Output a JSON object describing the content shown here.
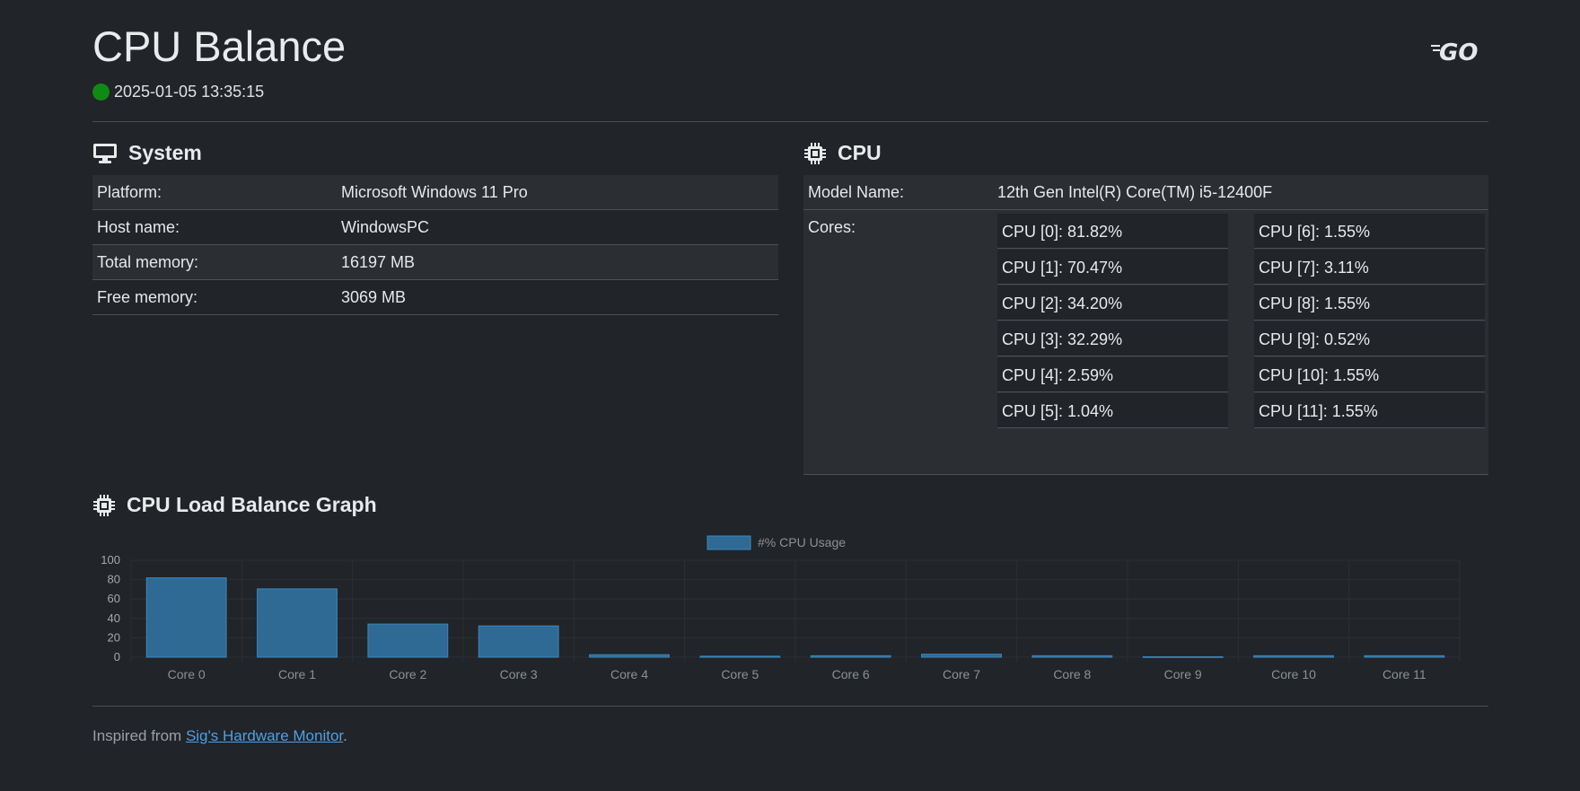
{
  "header": {
    "title": "CPU Balance",
    "timestamp": "2025-01-05 13:35:15",
    "status_color": "#0f8a12",
    "logo_icon": "go-logo"
  },
  "system": {
    "title": "System",
    "icon": "monitor-icon",
    "rows": [
      {
        "key": "Platform:",
        "value": "Microsoft Windows 11 Pro"
      },
      {
        "key": "Host name:",
        "value": "WindowsPC"
      },
      {
        "key": "Total memory:",
        "value": "16197 MB"
      },
      {
        "key": "Free memory:",
        "value": "3069 MB"
      }
    ]
  },
  "cpu": {
    "title": "CPU",
    "icon": "chip-icon",
    "model_label": "Model Name:",
    "model_value": "12th Gen Intel(R) Core(TM) i5-12400F",
    "cores_label": "Cores:",
    "cores_left": [
      "CPU [0]: 81.82%",
      "CPU [1]: 70.47%",
      "CPU [2]: 34.20%",
      "CPU [3]: 32.29%",
      "CPU [4]: 2.59%",
      "CPU [5]: 1.04%"
    ],
    "cores_right": [
      "CPU [6]: 1.55%",
      "CPU [7]: 3.11%",
      "CPU [8]: 1.55%",
      "CPU [9]: 0.52%",
      "CPU [10]: 1.55%",
      "CPU [11]: 1.55%"
    ]
  },
  "graph": {
    "title": "CPU Load Balance Graph",
    "icon": "chip-icon"
  },
  "chart_data": {
    "type": "bar",
    "categories": [
      "Core 0",
      "Core 1",
      "Core 2",
      "Core 3",
      "Core 4",
      "Core 5",
      "Core 6",
      "Core 7",
      "Core 8",
      "Core 9",
      "Core 10",
      "Core 11"
    ],
    "series": [
      {
        "name": "#% CPU Usage",
        "values": [
          81.82,
          70.47,
          34.2,
          32.29,
          2.59,
          1.04,
          1.55,
          3.11,
          1.55,
          0.52,
          1.55,
          1.55
        ]
      }
    ],
    "ylim": [
      0,
      100
    ],
    "yticks": [
      "0",
      "20",
      "40",
      "60",
      "80",
      "100"
    ],
    "grid": true,
    "legend": "top-center",
    "bar_color": "#2e6a94",
    "bar_border": "#3d87bd"
  },
  "footer": {
    "prefix": "Inspired from ",
    "link_text": "Sig's Hardware Monitor",
    "suffix": "."
  }
}
